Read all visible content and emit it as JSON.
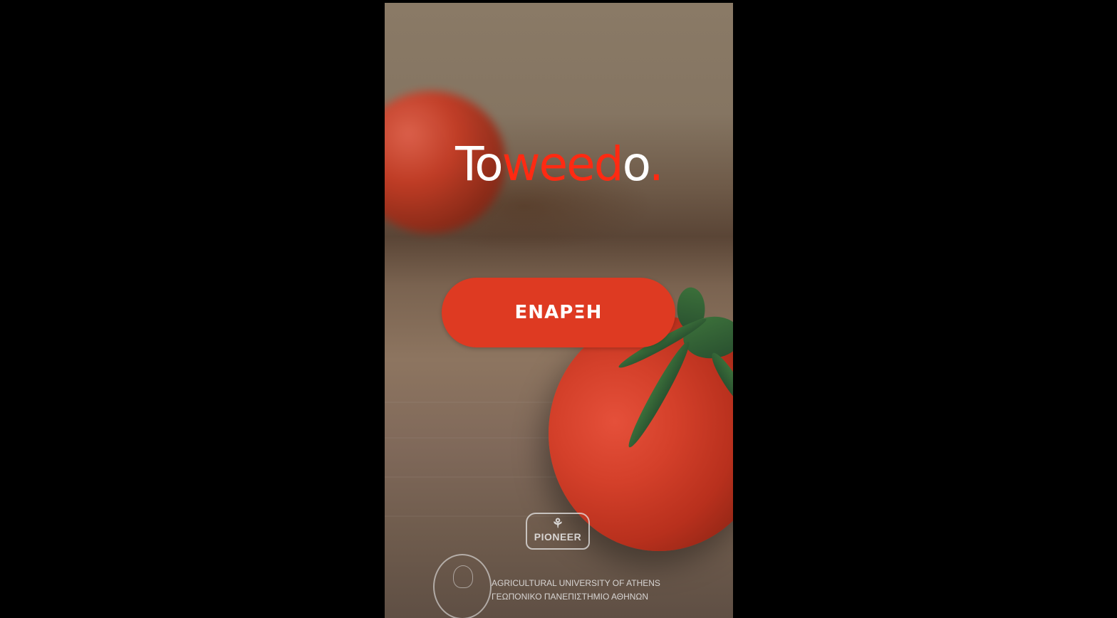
{
  "app": {
    "title_part1": "To",
    "title_part2": "weed",
    "title_part3": "o",
    "title_part4": "."
  },
  "start_button": {
    "label": "ΕΝΑΡΞΗ"
  },
  "sponsors": {
    "pioneer_label": "PIONEER",
    "university_en": "AGRICULTURAL UNIVERSITY OF ATHENS",
    "university_gr": "ΓΕΩΠΟΝΙΚΟ ΠΑΝΕΠΙΣΤΗΜΙΟ ΑΘΗΝΩΝ"
  },
  "colors": {
    "accent": "#de3a22",
    "title_red": "#ff2a12",
    "background": "#000000"
  }
}
